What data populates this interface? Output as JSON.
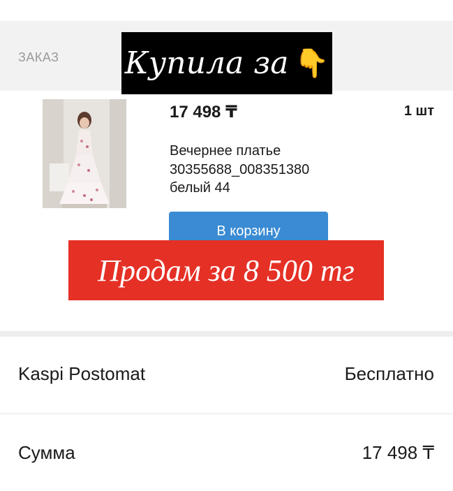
{
  "order": {
    "section_title": "ЗАКАЗ",
    "item": {
      "price": "17 498 ₸",
      "quantity": "1 шт",
      "name": "Вечернее платье",
      "sku": "30355688_008351380",
      "variant": "белый 44",
      "cart_button": "В корзину"
    }
  },
  "overlays": {
    "bought_text": "Купила за",
    "bought_icon": "pointing-down-hand-icon",
    "sell_text": "Продам за 8 500 тг"
  },
  "delivery": {
    "label": "Kaspi Postomat",
    "value": "Бесплатно"
  },
  "total": {
    "label": "Сумма",
    "value": "17 498 ₸"
  },
  "colors": {
    "button_blue": "#3a8bd3",
    "sell_red": "#e53026",
    "bought_black": "#000000"
  }
}
